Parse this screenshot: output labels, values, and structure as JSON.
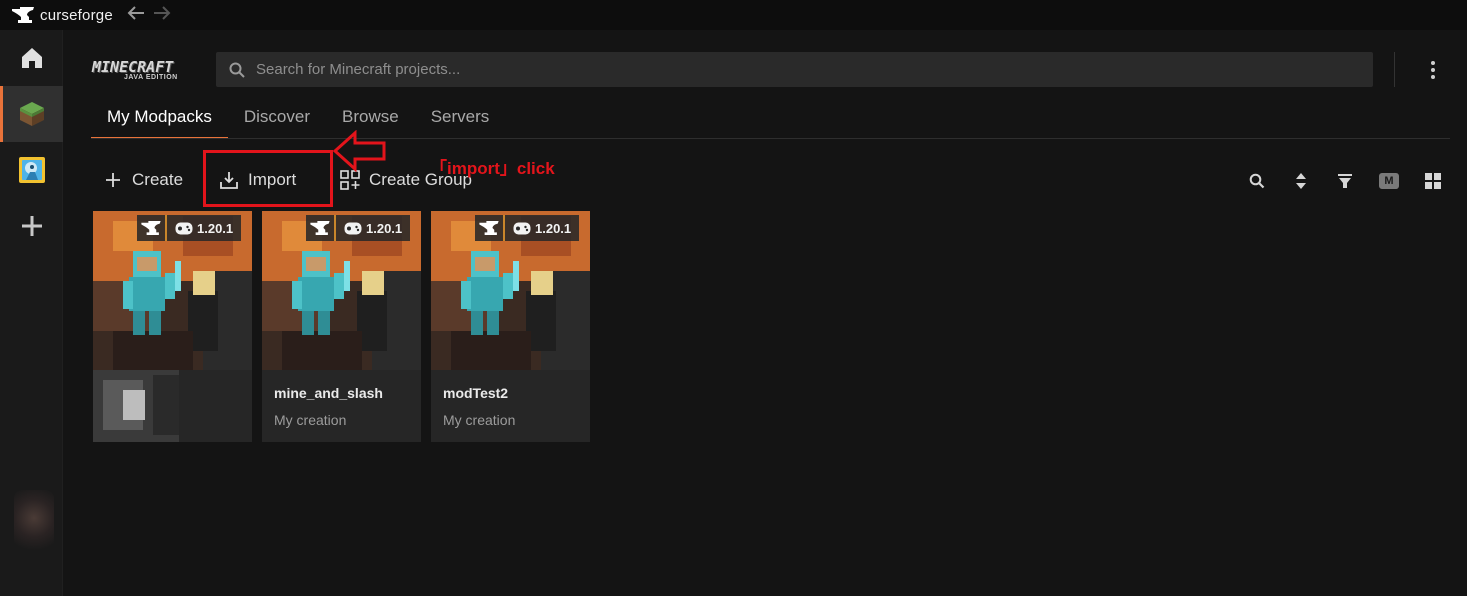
{
  "titlebar": {
    "app_name": "curseforge",
    "back_icon": "arrow-left-icon",
    "forward_icon": "arrow-right-icon"
  },
  "sidebar": {
    "items": [
      {
        "name": "home",
        "icon": "home-icon"
      },
      {
        "name": "minecraft",
        "icon": "grass-block-icon",
        "active": true
      },
      {
        "name": "game",
        "icon": "game-tile-icon"
      },
      {
        "name": "add-game",
        "icon": "plus-icon"
      }
    ]
  },
  "header": {
    "game_logo": {
      "title": "MINECRAFT",
      "edition": "JAVA EDITION"
    },
    "search_placeholder": "Search for Minecraft projects..."
  },
  "tabs": [
    {
      "label": "My Modpacks",
      "active": true
    },
    {
      "label": "Discover"
    },
    {
      "label": "Browse"
    },
    {
      "label": "Servers"
    }
  ],
  "toolbar": {
    "create_label": "Create",
    "import_label": "Import",
    "create_group_label": "Create Group",
    "m_badge": "M",
    "icons": [
      "search-icon",
      "sort-icon",
      "filter-icon",
      "m-badge-icon",
      "grid-view-icon"
    ]
  },
  "annotation": {
    "text": "「import」click",
    "color": "#e3141b"
  },
  "modpacks": [
    {
      "name": "",
      "subtitle": "",
      "version": "1.20.1",
      "loader_icon": "anvil-icon"
    },
    {
      "name": "mine_and_slash",
      "subtitle": "My creation",
      "version": "1.20.1",
      "loader_icon": "anvil-icon"
    },
    {
      "name": "modTest2",
      "subtitle": "My creation",
      "version": "1.20.1",
      "loader_icon": "anvil-icon"
    }
  ],
  "colors": {
    "accent": "#e9733a",
    "background": "#141414",
    "card": "#262626"
  }
}
